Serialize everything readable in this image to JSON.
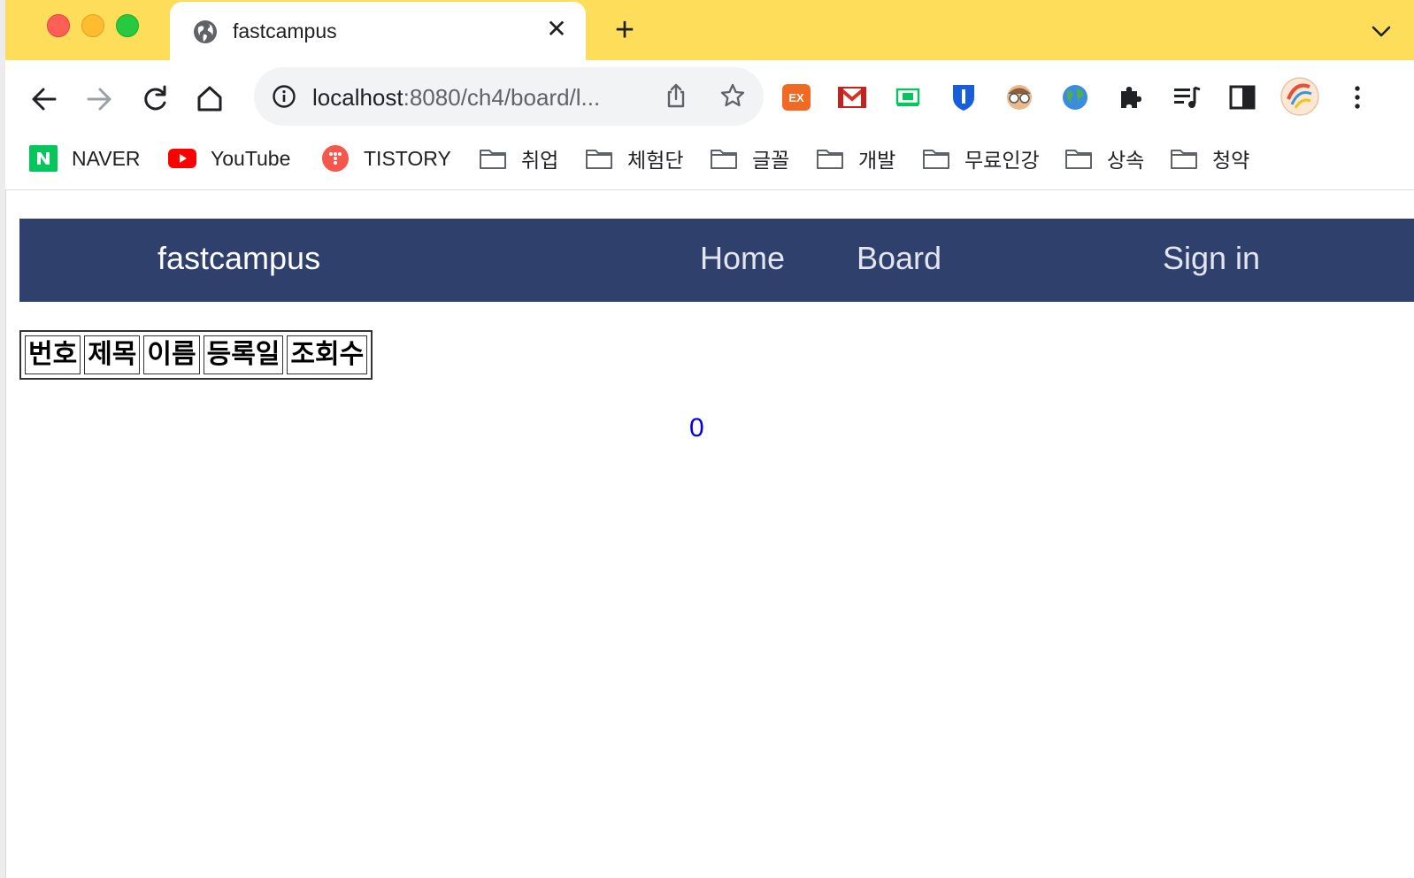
{
  "browser": {
    "tab": {
      "title": "fastcampus",
      "favicon": "globe-icon"
    },
    "newtab_label": "+",
    "close_label": "✕",
    "address": {
      "host": "localhost",
      "rest": ":8080/ch4/board/l..."
    },
    "extensions": [
      "ex-extension-icon",
      "gmail-icon",
      "naver-extension-icon",
      "bitwarden-icon",
      "avatar-extension-icon",
      "globe-extension-icon",
      "puzzle-icon",
      "media-control-icon",
      "side-panel-icon",
      "profile-avatar-icon",
      "more-menu-icon"
    ],
    "colors": {
      "tabstrip": "#fedd5b",
      "toolbar": "#ffffff"
    }
  },
  "bookmarks": [
    {
      "label": "NAVER",
      "icon": "naver-icon"
    },
    {
      "label": "YouTube",
      "icon": "youtube-icon"
    },
    {
      "label": "TISTORY",
      "icon": "tistory-icon"
    },
    {
      "label": "취업",
      "icon": "folder-icon"
    },
    {
      "label": "체험단",
      "icon": "folder-icon"
    },
    {
      "label": "글꼴",
      "icon": "folder-icon"
    },
    {
      "label": "개발",
      "icon": "folder-icon"
    },
    {
      "label": "무료인강",
      "icon": "folder-icon"
    },
    {
      "label": "상속",
      "icon": "folder-icon"
    },
    {
      "label": "청약",
      "icon": "folder-icon"
    }
  ],
  "site": {
    "nav": {
      "brand": "fastcampus",
      "home": "Home",
      "board": "Board",
      "signin": "Sign in",
      "bg_color": "#30406d"
    },
    "table": {
      "headers": [
        "번호",
        "제목",
        "이름",
        "등록일",
        "조회수"
      ]
    },
    "count": "0"
  }
}
